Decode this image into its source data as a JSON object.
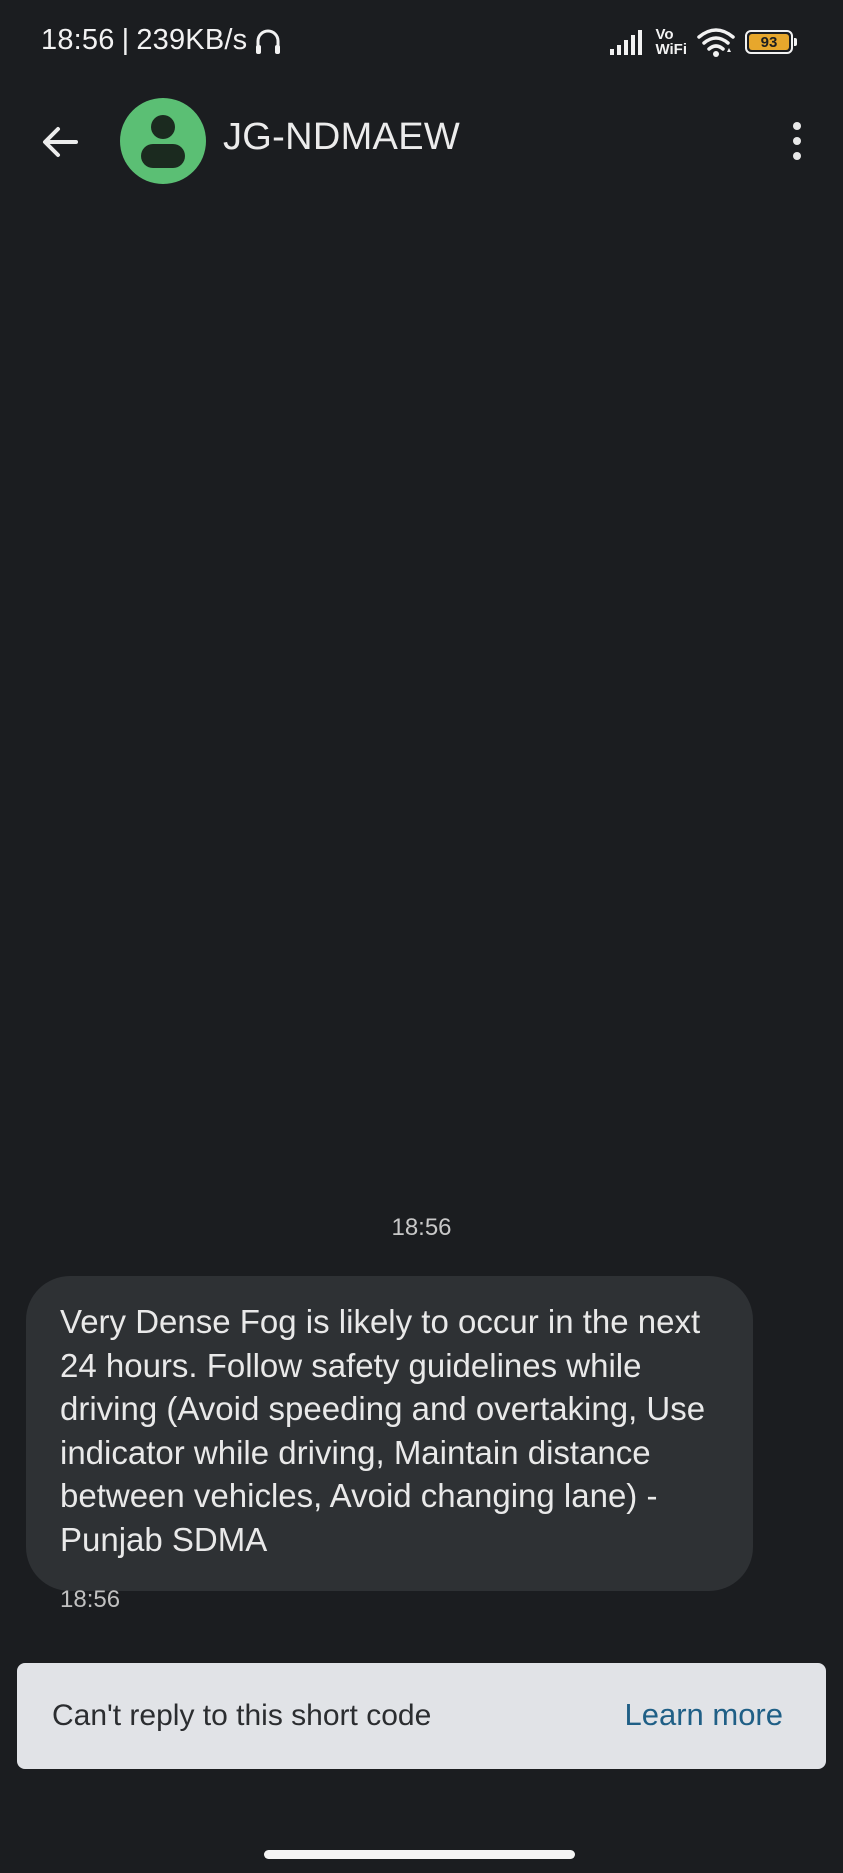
{
  "status_bar": {
    "time": "18:56",
    "separator": "|",
    "network_speed": "239KB/s",
    "vowifi_top": "Vo",
    "vowifi_bottom": "WiFi",
    "battery_level": "93",
    "battery_color": "#e7a72c",
    "icons": [
      "headphone-icon",
      "signal-icon",
      "vowifi-icon",
      "wifi-icon",
      "battery-icon"
    ]
  },
  "app_bar": {
    "contact_name": "JG-NDMAEW",
    "avatar_color": "#5bbf74",
    "back_icon": "arrow-left-icon",
    "menu_icon": "more-vertical-icon"
  },
  "conversation": {
    "date_divider": "18:56",
    "messages": [
      {
        "text": "Very Dense Fog is likely to occur in the next 24 hours. Follow safety guidelines while driving (Avoid speeding and overtaking, Use indicator while driving, Maintain distance between vehicles, Avoid changing lane) - Punjab SDMA",
        "time": "18:56"
      }
    ]
  },
  "notice": {
    "text": "Can't reply to this short code",
    "link_label": "Learn more",
    "link_color": "#1f5f86"
  }
}
